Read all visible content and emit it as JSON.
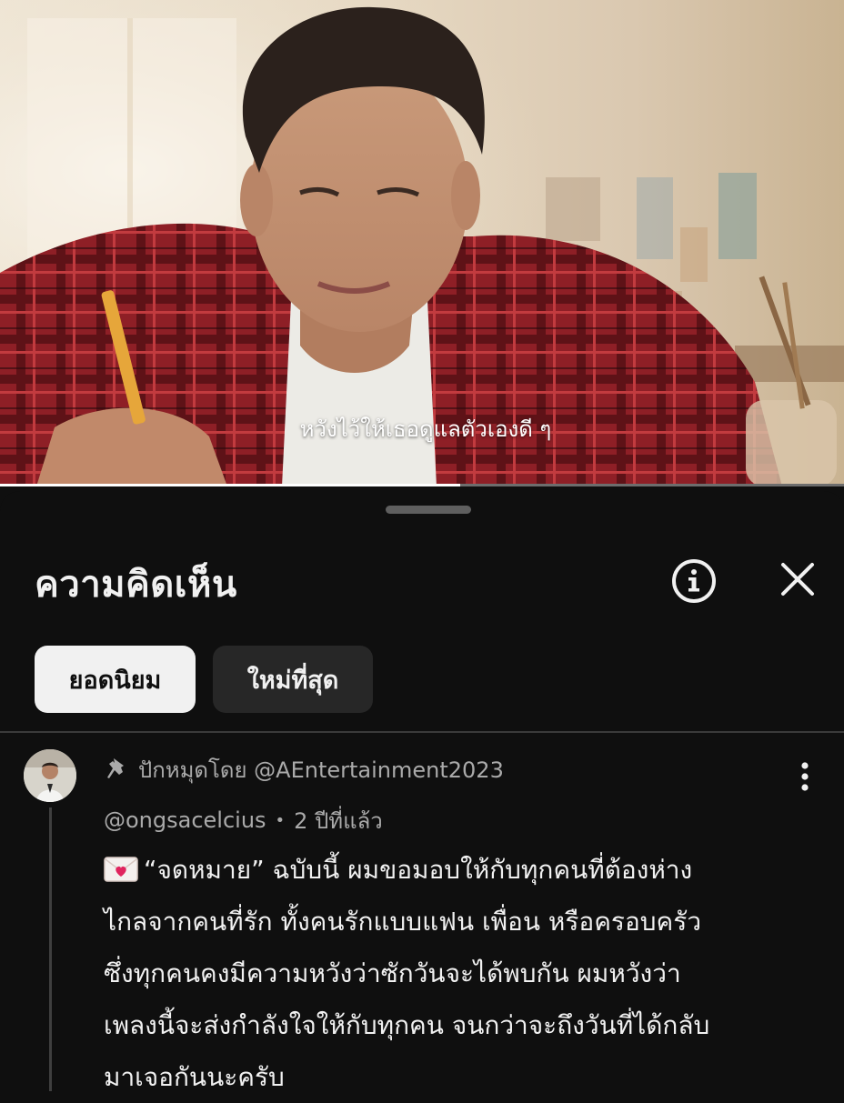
{
  "video": {
    "subtitle": "หวังไว้ให้เธอดูแลตัวเองดี ๆ",
    "progress": 0.545
  },
  "comments_panel": {
    "title": "ความคิดเห็น",
    "info_icon": "info-icon",
    "close_icon": "close-icon",
    "filters": [
      {
        "label": "ยอดนิยม",
        "selected": true
      },
      {
        "label": "ใหม่ที่สุด",
        "selected": false
      }
    ]
  },
  "pinned_comment": {
    "pin_icon": "pin-icon",
    "pinned_by": "ปักหมุดโดย @AEntertainment2023",
    "author": "@ongsacelcius",
    "time": "2 ปีที่แล้ว",
    "emoji_icon": "love-letter-icon",
    "text_lines": [
      "“จดหมาย” ฉบับนี้ ผมขอมอบให้กับทุกคนที่ต้องห่าง",
      "ไกลจากคนที่รัก ทั้งคนรักแบบแฟน เพื่อน หรือครอบครัว",
      "ซึ่งทุกคนคงมีความหวังว่าซักวันจะได้พบกัน ผมหวังว่า",
      "เพลงนี้จะส่งกำลังใจให้กับทุกคน จนกว่าจะถึงวันที่ได้กลับ",
      "มาเจอกันนะครับ"
    ],
    "more_icon": "more-vertical-icon"
  }
}
